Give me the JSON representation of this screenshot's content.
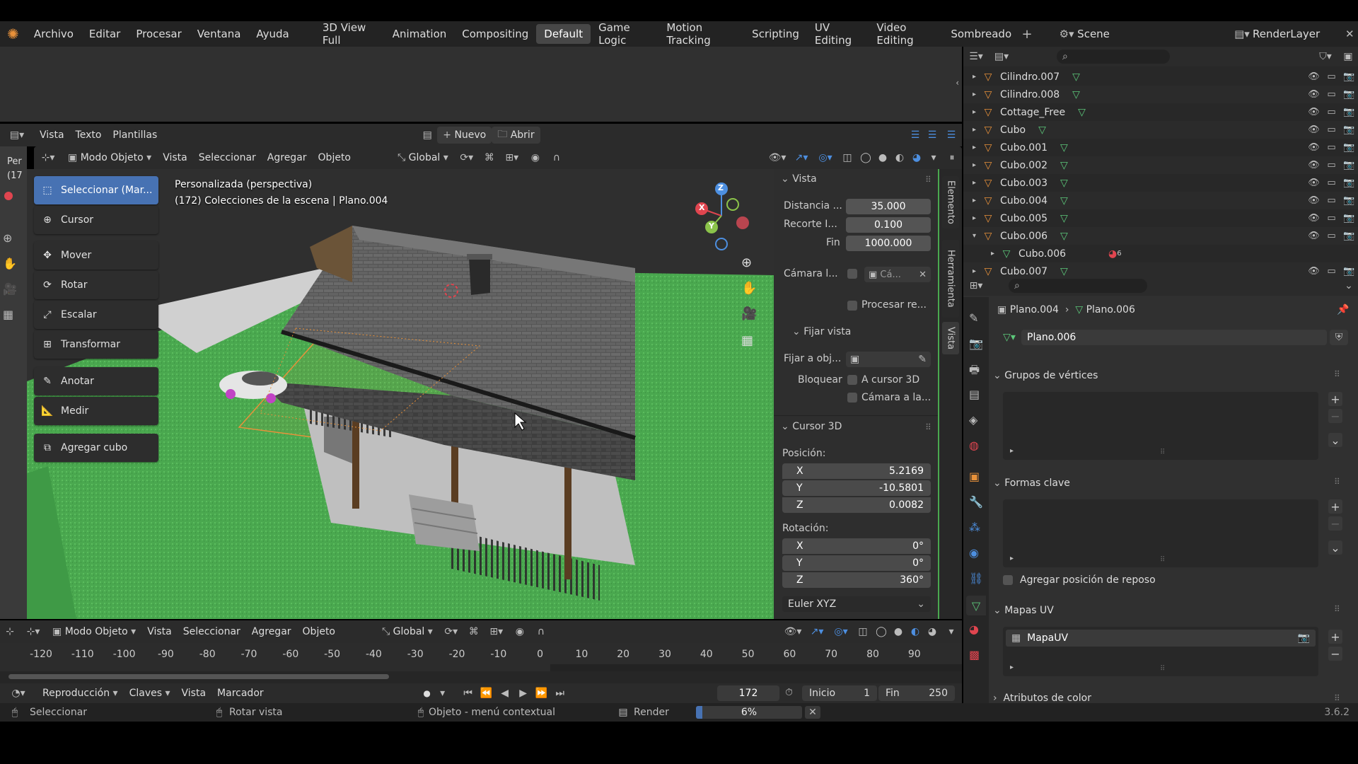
{
  "topbar": {
    "menus": [
      "Archivo",
      "Editar",
      "Procesar",
      "Ventana",
      "Ayuda"
    ],
    "workspaces": [
      "3D View Full",
      "Animation",
      "Compositing",
      "Default",
      "Game Logic",
      "Motion Tracking",
      "Scripting",
      "UV Editing",
      "Video Editing",
      "Sombreado"
    ],
    "active_workspace": "Default",
    "scene": "Scene",
    "render_layer": "RenderLayer"
  },
  "text_editor": {
    "menus": [
      "Vista",
      "Texto",
      "Plantillas"
    ],
    "new_label": "Nuevo",
    "open_label": "Abrir"
  },
  "viewport_header": {
    "mode": "Modo Objeto",
    "menus": [
      "Vista",
      "Seleccionar",
      "Agregar",
      "Objeto"
    ],
    "transform": "Global"
  },
  "viewport": {
    "view_name": "Personalizada (perspectiva)",
    "collection_info": "(172) Colecciones de la escena | Plano.004",
    "left_clip_1": "Per",
    "left_clip_2": "(17",
    "gizmo": {
      "x": "X",
      "y": "Y",
      "z": "Z"
    }
  },
  "toolbar": {
    "tools": [
      "Seleccionar (Mar...",
      "Cursor",
      "Mover",
      "Rotar",
      "Escalar",
      "Transformar",
      "Anotar",
      "Medir",
      "Agregar cubo"
    ]
  },
  "npanel": {
    "vista_title": "Vista",
    "distancia_label": "Distancia ...",
    "distancia": "35.000",
    "recorte_label": "Recorte I...",
    "recorte": "0.100",
    "fin_label": "Fin",
    "fin": "1000.000",
    "camara_label": "Cámara l...",
    "camara_value": "Cá...",
    "procesar_label": "Procesar re...",
    "fijar_vista_title": "Fijar vista",
    "fijar_obj_label": "Fijar a obj...",
    "bloquear_label": "Bloquear",
    "a_cursor_label": "A cursor 3D",
    "camara_a_label": "Cámara a la...",
    "cursor_title": "Cursor 3D",
    "posicion_label": "Posición:",
    "pos": {
      "x": "5.2169",
      "y": "-10.5801",
      "z": "0.0082"
    },
    "rotacion_label": "Rotación:",
    "rot": {
      "x": "0°",
      "y": "0°",
      "z": "360°"
    },
    "axis_labels": {
      "x": "X",
      "y": "Y",
      "z": "Z"
    },
    "rot_mode": "Euler XYZ",
    "tabs": [
      "Elemento",
      "Herramienta",
      "Vista"
    ]
  },
  "timeline": {
    "mode": "Modo Objeto",
    "menus": [
      "Vista",
      "Seleccionar",
      "Agregar",
      "Objeto"
    ],
    "transform": "Global",
    "ruler": [
      "-120",
      "-110",
      "-100",
      "-90",
      "-80",
      "-70",
      "-60",
      "-50",
      "-40",
      "-30",
      "-20",
      "-10",
      "0",
      "10",
      "20",
      "30",
      "40",
      "50",
      "60",
      "70",
      "80",
      "90"
    ],
    "playback_menus": [
      "Reproducción",
      "Claves",
      "Vista",
      "Marcador"
    ],
    "current_frame": "172",
    "inicio_label": "Inicio",
    "inicio": "1",
    "fin_label": "Fin",
    "fin": "250"
  },
  "status": {
    "select": "Seleccionar",
    "rotate": "Rotar vista",
    "context": "Objeto - menú contextual",
    "render_label": "Render",
    "render_progress": "6%",
    "version": "3.6.2"
  },
  "outliner": {
    "items": [
      {
        "name": "Cilindro.007",
        "expanded": false
      },
      {
        "name": "Cilindro.008",
        "expanded": false
      },
      {
        "name": "Cottage_Free",
        "expanded": false
      },
      {
        "name": "Cubo",
        "expanded": false
      },
      {
        "name": "Cubo.001",
        "expanded": false
      },
      {
        "name": "Cubo.002",
        "expanded": false
      },
      {
        "name": "Cubo.003",
        "expanded": false
      },
      {
        "name": "Cubo.004",
        "expanded": false
      },
      {
        "name": "Cubo.005",
        "expanded": false
      },
      {
        "name": "Cubo.006",
        "expanded": true
      },
      {
        "name": "Cubo.006",
        "expanded": false,
        "child": true
      },
      {
        "name": "Cubo.007",
        "expanded": false
      }
    ],
    "child_count": "6"
  },
  "properties": {
    "breadcrumb_object": "Plano.004",
    "breadcrumb_mesh": "Plano.006",
    "mesh_name": "Plano.006",
    "sections": {
      "vertex_groups": "Grupos de vértices",
      "shape_keys": "Formas clave",
      "rest_position": "Agregar posición de reposo",
      "uv_maps": "Mapas UV",
      "color_attributes": "Atributos de color"
    },
    "uv_map_name": "MapaUV"
  },
  "colors": {
    "accent": "#4772b3",
    "panel_bg": "#303030",
    "object_orange": "#e8913a",
    "mesh_green": "#5cc87a",
    "axis_x": "#e0454f",
    "axis_y": "#8bc34a",
    "axis_z": "#4d8fe0"
  }
}
